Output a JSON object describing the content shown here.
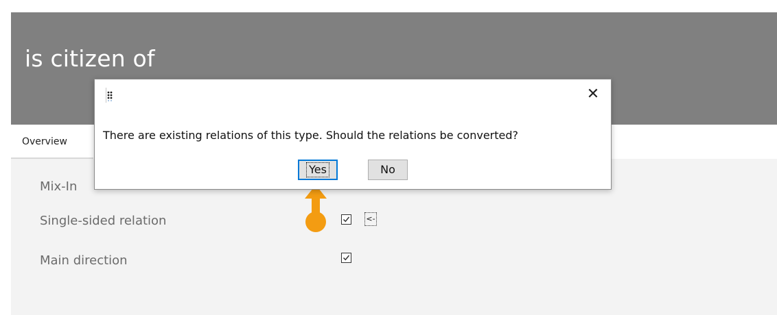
{
  "page": {
    "title": "is citizen of"
  },
  "tabs": [
    {
      "label": "Overview"
    }
  ],
  "properties": {
    "mixin": {
      "label": "Mix-In"
    },
    "single_sided": {
      "label": "Single-sided relation",
      "checked": true,
      "direction_button": "<-"
    },
    "main_direction": {
      "label": "Main direction",
      "checked": true
    }
  },
  "dialog": {
    "message": "There are existing relations of this type. Should the relations be converted?",
    "yes_label": "Yes",
    "no_label": "No",
    "close_icon": "close-icon",
    "app_icon": "app-icon"
  },
  "colors": {
    "header_bg": "#808080",
    "panel_bg": "#f3f3f3",
    "callout": "#f39c12",
    "focus_border": "#0078d7"
  }
}
